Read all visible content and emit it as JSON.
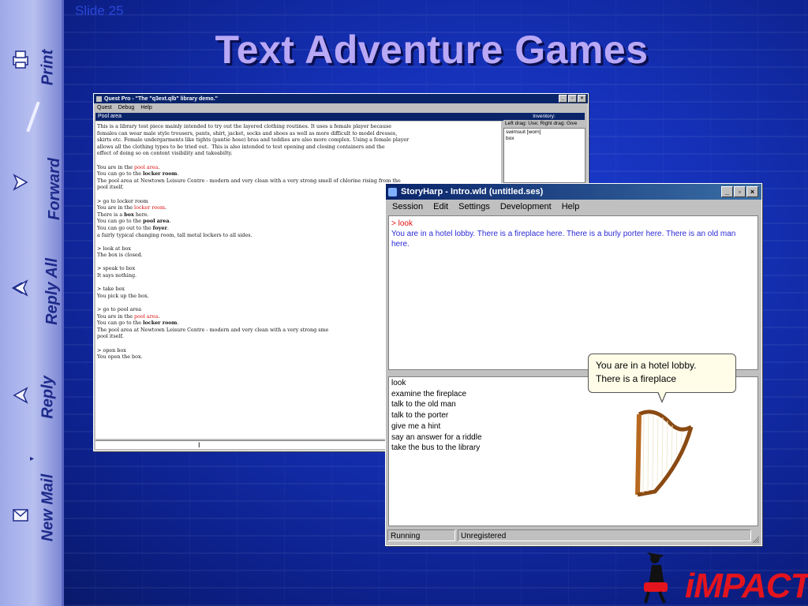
{
  "slide": {
    "number_label": "Slide 25",
    "title": "Text Adventure Games"
  },
  "sidebar": {
    "items": [
      {
        "label": "Print",
        "icon": "printer-icon"
      },
      {
        "label": "Forward",
        "icon": "forward-mail-icon"
      },
      {
        "label": "Reply All",
        "icon": "reply-all-icon"
      },
      {
        "label": "Reply",
        "icon": "reply-icon"
      },
      {
        "label": "New Mail",
        "icon": "new-mail-icon"
      }
    ]
  },
  "questpro": {
    "title": "Quest Pro - \"The \"q3ext.qlb\" library demo.\"",
    "menu": [
      "Quest",
      "Debug",
      "Help"
    ],
    "location": "Pool area",
    "inventory_header": "Inventory:",
    "inventory_hint": "Left drag: Use; Right drag: Give",
    "inventory_items": [
      "swimsuit [worn]",
      "box"
    ],
    "transcript": [
      [
        {
          "t": "This is a library test piece mainly intended to try out the layered clothing routines. It uses a female player because"
        }
      ],
      [
        {
          "t": "females can wear male style trousers, pants, shirt, jacket, socks and shoes as well as more difficult to model dresses,"
        }
      ],
      [
        {
          "t": "skirts etc. Female undergarments like tights (pantie hose) bras and teddies are also more complex. Using a female player"
        }
      ],
      [
        {
          "t": "allows all the clothing types to be tried out.  This is also intended to test opening and closing containers and the"
        }
      ],
      [
        {
          "t": "effect of doing so on content visibility and takeabilty."
        }
      ],
      [
        {
          "t": ""
        }
      ],
      [
        {
          "t": "You are in the "
        },
        {
          "t": "pool area",
          "c": "red"
        },
        {
          "t": "."
        }
      ],
      [
        {
          "t": "You can go to the "
        },
        {
          "t": "locker room",
          "b": true
        },
        {
          "t": "."
        }
      ],
      [
        {
          "t": "The pool area at Newtown Leisure Centre - modern and very clean with a very strong smell of chlorine rising from the"
        }
      ],
      [
        {
          "t": "pool itself."
        }
      ],
      [
        {
          "t": ""
        }
      ],
      [
        {
          "t": "> go to locker room"
        }
      ],
      [
        {
          "t": "You are in the "
        },
        {
          "t": "locker room",
          "c": "red"
        },
        {
          "t": "."
        }
      ],
      [
        {
          "t": "There is a "
        },
        {
          "t": "box",
          "b": true
        },
        {
          "t": " here."
        }
      ],
      [
        {
          "t": "You can go to the "
        },
        {
          "t": "pool area",
          "b": true
        },
        {
          "t": "."
        }
      ],
      [
        {
          "t": "You can go out to the "
        },
        {
          "t": "foyer",
          "b": true
        },
        {
          "t": "."
        }
      ],
      [
        {
          "t": "a fairly typical changing room, tall metal lockers to all sides."
        }
      ],
      [
        {
          "t": ""
        }
      ],
      [
        {
          "t": "> look at box"
        }
      ],
      [
        {
          "t": "The box is closed."
        }
      ],
      [
        {
          "t": ""
        }
      ],
      [
        {
          "t": "> speak to box"
        }
      ],
      [
        {
          "t": "It says nothing."
        }
      ],
      [
        {
          "t": ""
        }
      ],
      [
        {
          "t": "> take box"
        }
      ],
      [
        {
          "t": "You pick up the box."
        }
      ],
      [
        {
          "t": ""
        }
      ],
      [
        {
          "t": "> go to pool area"
        }
      ],
      [
        {
          "t": "You are in the "
        },
        {
          "t": "pool area",
          "c": "red"
        },
        {
          "t": "."
        }
      ],
      [
        {
          "t": "You can go to the "
        },
        {
          "t": "locker room",
          "b": true
        },
        {
          "t": "."
        }
      ],
      [
        {
          "t": "The pool area at Newtown Leisure Centre - modern and very clean with a very strong sme"
        }
      ],
      [
        {
          "t": "pool itself."
        }
      ],
      [
        {
          "t": ""
        }
      ],
      [
        {
          "t": "> open box"
        }
      ],
      [
        {
          "t": "You open the box."
        }
      ]
    ]
  },
  "storyharp": {
    "title": "StoryHarp - Intro.wld (untitled.ses)",
    "menu": [
      "Session",
      "Edit",
      "Settings",
      "Development",
      "Help"
    ],
    "output_command": "> look",
    "output_response": "You are in a hotel lobby. There is a fireplace here. There is a burly porter here. There is an old man here.",
    "commands": [
      "look",
      "examine the fireplace",
      "talk to the old man",
      "talk to the porter",
      "give me a hint",
      "say an answer for a riddle",
      "take the bus to the library"
    ],
    "bubble_line1": "You are in a hotel lobby.",
    "bubble_line2": "There is a fireplace",
    "status_left": "Running",
    "status_right": "Unregistered"
  },
  "logo": {
    "text": "iMPACT"
  },
  "colors": {
    "title": "#b9a8f5",
    "accent_red": "#e01010",
    "response_blue": "#2b2bd6",
    "titlebar": "#0a246a"
  }
}
